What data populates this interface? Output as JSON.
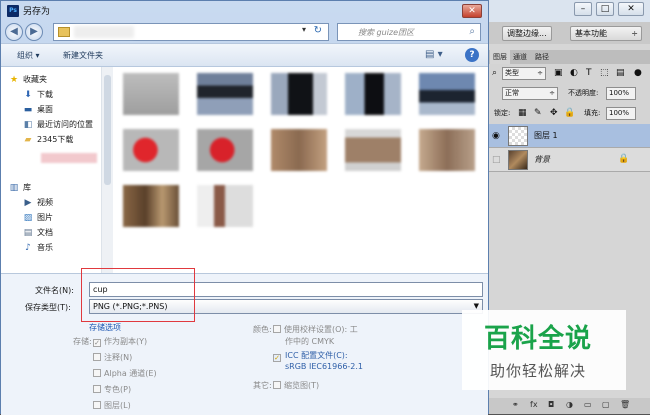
{
  "dialog": {
    "title": "另存为",
    "app_icon_label": "Ps",
    "close_label": "✕"
  },
  "address": {
    "search_placeholder": "搜索 guize团区"
  },
  "toolbar": {
    "organize_label": "组织 ▾",
    "new_folder_label": "新建文件夹"
  },
  "nav": {
    "favorites_label": "收藏夹",
    "items": [
      {
        "label": "下载",
        "icon": "download-folder-icon"
      },
      {
        "label": "桌面",
        "icon": "desktop-icon"
      },
      {
        "label": "最近访问的位置",
        "icon": "recent-places-icon"
      },
      {
        "label": "2345下载",
        "icon": "folder-icon"
      }
    ],
    "library_label": "库",
    "library_items": [
      {
        "label": "视频",
        "icon": "video-icon"
      },
      {
        "label": "图片",
        "icon": "pictures-icon"
      },
      {
        "label": "文档",
        "icon": "documents-icon"
      },
      {
        "label": "音乐",
        "icon": "music-icon"
      }
    ]
  },
  "form": {
    "filename_label": "文件名(N):",
    "filename_value": "cup",
    "filetype_label": "保存类型(T):",
    "filetype_value": "PNG (*.PNG;*.PNS)",
    "save_options_label": "存储选项",
    "storage_label": "存储:",
    "as_copy_label": "作为副本(Y)",
    "notes_label": "注释(N)",
    "alpha_label": "Alpha 通道(E)",
    "spot_label": "专色(P)",
    "layers_label": "图层(L)",
    "color_label": "颜色:",
    "proof_label": "使用校样设置(O): 工",
    "proof_label2": "作中的 CMYK",
    "icc_label": "ICC 配置文件(C):",
    "icc_value": "sRGB IEC61966-2.1",
    "other_label": "其它:",
    "thumbnail_label": "缩览图(T)"
  },
  "photoshop": {
    "adjust_edge_label": "调整边缘...",
    "workspace_label": "基本功能",
    "tabs": [
      "图层",
      "通道",
      "路径"
    ],
    "kind_label": "类型",
    "blend_mode": "正常",
    "opacity_label": "不透明度:",
    "opacity_value": "100%",
    "lock_label": "锁定:",
    "fill_label": "填充:",
    "fill_value": "100%",
    "layers": [
      {
        "name": "图层 1"
      },
      {
        "name": "背景"
      }
    ]
  },
  "watermark": {
    "title": "百科全说",
    "subtitle": "助你轻松解决"
  },
  "colors": {
    "highlight_red": "#e0393e",
    "link_blue": "#1f58b3",
    "watermark_green": "#1aa34a"
  }
}
